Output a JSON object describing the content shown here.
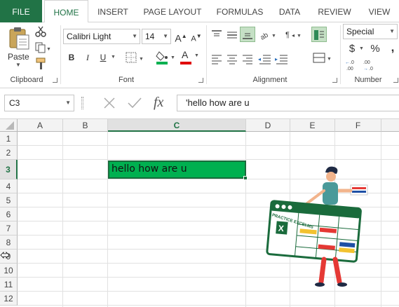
{
  "tabs": [
    {
      "label": "FILE"
    },
    {
      "label": "HOME"
    },
    {
      "label": "INSERT"
    },
    {
      "label": "PAGE LAYOUT"
    },
    {
      "label": "FORMULAS"
    },
    {
      "label": "DATA"
    },
    {
      "label": "REVIEW"
    },
    {
      "label": "VIEW"
    }
  ],
  "ribbon": {
    "clipboard": {
      "paste_label": "Paste",
      "group_label": "Clipboard"
    },
    "font": {
      "name": "Calibri Light",
      "size": "14",
      "group_label": "Font",
      "bold": "B",
      "italic": "I",
      "underline": "U",
      "grow": "A",
      "shrink": "A",
      "font_color_letter": "A"
    },
    "alignment": {
      "group_label": "Alignment"
    },
    "number": {
      "format": "Special",
      "group_label": "Number",
      "currency": "$",
      "percent": "%",
      "comma": ","
    }
  },
  "formula_bar": {
    "name_box": "C3",
    "content": "'hello how are u",
    "fx": "fx"
  },
  "grid": {
    "columns": [
      "A",
      "B",
      "C",
      "D",
      "E",
      "F"
    ],
    "rows": [
      "1",
      "2",
      "3",
      "4",
      "5",
      "6",
      "7",
      "8",
      "9",
      "10",
      "11",
      "12"
    ],
    "active_cell_value": "hello how are u",
    "selected_column": "C",
    "selected_row": "3"
  },
  "illustration": {
    "logo_text": "PRACTICE EXCELMS"
  },
  "colors": {
    "excel_green": "#217346",
    "cell_fill": "#00b050"
  }
}
